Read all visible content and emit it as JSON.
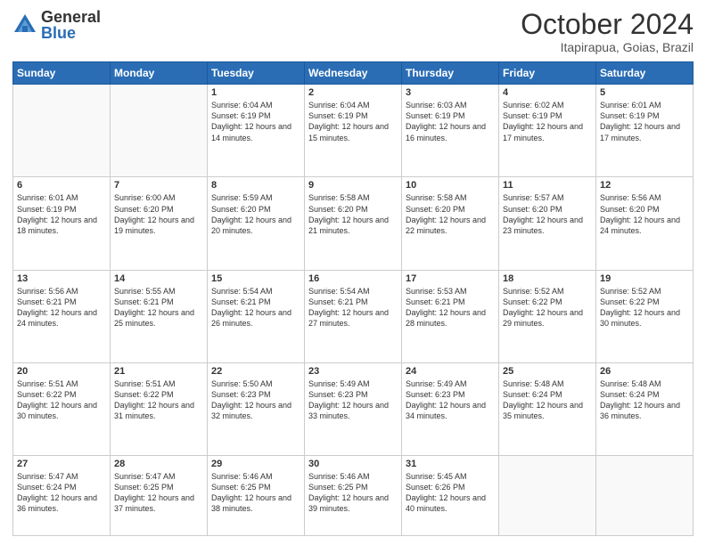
{
  "logo": {
    "general": "General",
    "blue": "Blue"
  },
  "title": "October 2024",
  "location": "Itapirapua, Goias, Brazil",
  "days_of_week": [
    "Sunday",
    "Monday",
    "Tuesday",
    "Wednesday",
    "Thursday",
    "Friday",
    "Saturday"
  ],
  "weeks": [
    [
      {
        "day": "",
        "info": ""
      },
      {
        "day": "",
        "info": ""
      },
      {
        "day": "1",
        "info": "Sunrise: 6:04 AM\nSunset: 6:19 PM\nDaylight: 12 hours and 14 minutes."
      },
      {
        "day": "2",
        "info": "Sunrise: 6:04 AM\nSunset: 6:19 PM\nDaylight: 12 hours and 15 minutes."
      },
      {
        "day": "3",
        "info": "Sunrise: 6:03 AM\nSunset: 6:19 PM\nDaylight: 12 hours and 16 minutes."
      },
      {
        "day": "4",
        "info": "Sunrise: 6:02 AM\nSunset: 6:19 PM\nDaylight: 12 hours and 17 minutes."
      },
      {
        "day": "5",
        "info": "Sunrise: 6:01 AM\nSunset: 6:19 PM\nDaylight: 12 hours and 17 minutes."
      }
    ],
    [
      {
        "day": "6",
        "info": "Sunrise: 6:01 AM\nSunset: 6:19 PM\nDaylight: 12 hours and 18 minutes."
      },
      {
        "day": "7",
        "info": "Sunrise: 6:00 AM\nSunset: 6:20 PM\nDaylight: 12 hours and 19 minutes."
      },
      {
        "day": "8",
        "info": "Sunrise: 5:59 AM\nSunset: 6:20 PM\nDaylight: 12 hours and 20 minutes."
      },
      {
        "day": "9",
        "info": "Sunrise: 5:58 AM\nSunset: 6:20 PM\nDaylight: 12 hours and 21 minutes."
      },
      {
        "day": "10",
        "info": "Sunrise: 5:58 AM\nSunset: 6:20 PM\nDaylight: 12 hours and 22 minutes."
      },
      {
        "day": "11",
        "info": "Sunrise: 5:57 AM\nSunset: 6:20 PM\nDaylight: 12 hours and 23 minutes."
      },
      {
        "day": "12",
        "info": "Sunrise: 5:56 AM\nSunset: 6:20 PM\nDaylight: 12 hours and 24 minutes."
      }
    ],
    [
      {
        "day": "13",
        "info": "Sunrise: 5:56 AM\nSunset: 6:21 PM\nDaylight: 12 hours and 24 minutes."
      },
      {
        "day": "14",
        "info": "Sunrise: 5:55 AM\nSunset: 6:21 PM\nDaylight: 12 hours and 25 minutes."
      },
      {
        "day": "15",
        "info": "Sunrise: 5:54 AM\nSunset: 6:21 PM\nDaylight: 12 hours and 26 minutes."
      },
      {
        "day": "16",
        "info": "Sunrise: 5:54 AM\nSunset: 6:21 PM\nDaylight: 12 hours and 27 minutes."
      },
      {
        "day": "17",
        "info": "Sunrise: 5:53 AM\nSunset: 6:21 PM\nDaylight: 12 hours and 28 minutes."
      },
      {
        "day": "18",
        "info": "Sunrise: 5:52 AM\nSunset: 6:22 PM\nDaylight: 12 hours and 29 minutes."
      },
      {
        "day": "19",
        "info": "Sunrise: 5:52 AM\nSunset: 6:22 PM\nDaylight: 12 hours and 30 minutes."
      }
    ],
    [
      {
        "day": "20",
        "info": "Sunrise: 5:51 AM\nSunset: 6:22 PM\nDaylight: 12 hours and 30 minutes."
      },
      {
        "day": "21",
        "info": "Sunrise: 5:51 AM\nSunset: 6:22 PM\nDaylight: 12 hours and 31 minutes."
      },
      {
        "day": "22",
        "info": "Sunrise: 5:50 AM\nSunset: 6:23 PM\nDaylight: 12 hours and 32 minutes."
      },
      {
        "day": "23",
        "info": "Sunrise: 5:49 AM\nSunset: 6:23 PM\nDaylight: 12 hours and 33 minutes."
      },
      {
        "day": "24",
        "info": "Sunrise: 5:49 AM\nSunset: 6:23 PM\nDaylight: 12 hours and 34 minutes."
      },
      {
        "day": "25",
        "info": "Sunrise: 5:48 AM\nSunset: 6:24 PM\nDaylight: 12 hours and 35 minutes."
      },
      {
        "day": "26",
        "info": "Sunrise: 5:48 AM\nSunset: 6:24 PM\nDaylight: 12 hours and 36 minutes."
      }
    ],
    [
      {
        "day": "27",
        "info": "Sunrise: 5:47 AM\nSunset: 6:24 PM\nDaylight: 12 hours and 36 minutes."
      },
      {
        "day": "28",
        "info": "Sunrise: 5:47 AM\nSunset: 6:25 PM\nDaylight: 12 hours and 37 minutes."
      },
      {
        "day": "29",
        "info": "Sunrise: 5:46 AM\nSunset: 6:25 PM\nDaylight: 12 hours and 38 minutes."
      },
      {
        "day": "30",
        "info": "Sunrise: 5:46 AM\nSunset: 6:25 PM\nDaylight: 12 hours and 39 minutes."
      },
      {
        "day": "31",
        "info": "Sunrise: 5:45 AM\nSunset: 6:26 PM\nDaylight: 12 hours and 40 minutes."
      },
      {
        "day": "",
        "info": ""
      },
      {
        "day": "",
        "info": ""
      }
    ]
  ]
}
